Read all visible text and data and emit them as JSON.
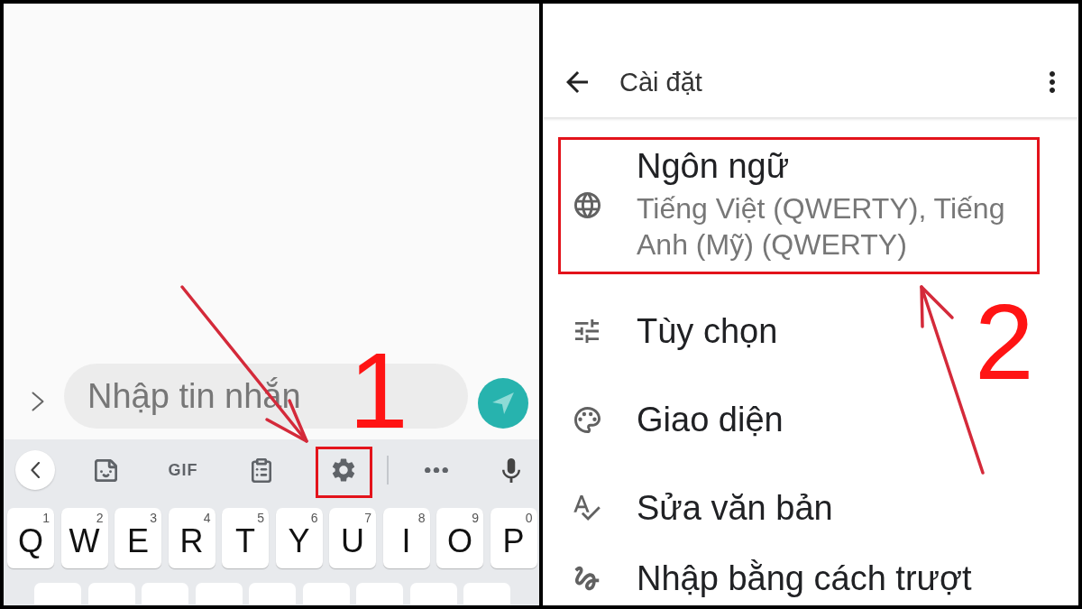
{
  "message_screen": {
    "message_input": {
      "placeholder": "Nhập tin nhắn"
    },
    "keyboard": {
      "toolbar": {
        "items": [
          {
            "kind": "collapse",
            "highlighted": false
          },
          {
            "kind": "sticker",
            "highlighted": false
          },
          {
            "kind": "gif",
            "label": "GIF",
            "highlighted": false
          },
          {
            "kind": "clipboard",
            "highlighted": false
          },
          {
            "kind": "settings",
            "highlighted": true
          }
        ],
        "end_items": [
          {
            "kind": "more",
            "highlighted": false
          },
          {
            "kind": "voice",
            "highlighted": false
          }
        ]
      },
      "keys": [
        {
          "letter": "Q",
          "hint": "1"
        },
        {
          "letter": "W",
          "hint": "2"
        },
        {
          "letter": "E",
          "hint": "3"
        },
        {
          "letter": "R",
          "hint": "4"
        },
        {
          "letter": "T",
          "hint": "5"
        },
        {
          "letter": "Y",
          "hint": "6"
        },
        {
          "letter": "U",
          "hint": "7"
        },
        {
          "letter": "I",
          "hint": "8"
        },
        {
          "letter": "O",
          "hint": "9"
        },
        {
          "letter": "P",
          "hint": "0"
        }
      ]
    },
    "step_label": "1"
  },
  "settings_screen": {
    "title": "Cài đặt",
    "items": [
      {
        "kind": "language",
        "title": "Ngôn ngữ",
        "subtitle": "Tiếng Việt (QWERTY), Tiếng Anh (Mỹ) (QWERTY)",
        "highlighted": true
      },
      {
        "kind": "preferences",
        "title": "Tùy chọn",
        "highlighted": false
      },
      {
        "kind": "theme",
        "title": "Giao diện",
        "highlighted": false
      },
      {
        "kind": "text-correction",
        "title": "Sửa văn bản",
        "highlighted": false
      },
      {
        "kind": "glide-typing",
        "title": "Nhập bằng cách trượt",
        "highlighted": false
      }
    ],
    "step_label": "2"
  }
}
